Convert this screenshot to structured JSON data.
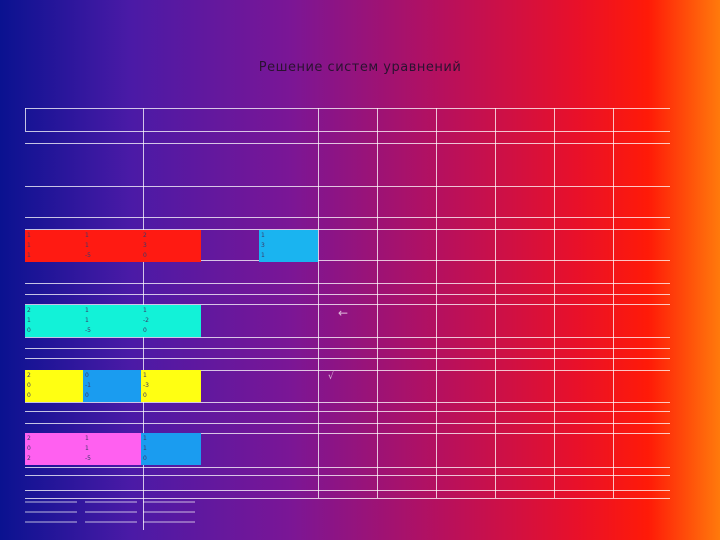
{
  "title": "Решение систем уравнений",
  "colors": {
    "red": "#ff1a12",
    "cyan": "#1ab4f0",
    "mint": "#12f2d8",
    "blue": "#1a9cf0",
    "yellow": "#ffff12",
    "pink": "#ff60f0"
  },
  "matrices": [
    {
      "name": "matrix-1-red",
      "rows": [
        [
          "1",
          "1",
          "2"
        ],
        [
          "1",
          "1",
          "3"
        ],
        [
          "1",
          "-5",
          "0"
        ]
      ]
    },
    {
      "name": "vector-1-cyan",
      "rows": [
        [
          "1"
        ],
        [
          "3"
        ],
        [
          "1"
        ]
      ]
    },
    {
      "name": "matrix-2-mint",
      "rows": [
        [
          "2",
          "1",
          "1"
        ],
        [
          "1",
          "1",
          "-2"
        ],
        [
          "0",
          "-5",
          "0"
        ]
      ]
    },
    {
      "name": "matrix-3-yellow",
      "rows": [
        [
          "2",
          "0",
          "1"
        ],
        [
          "0",
          "-1",
          "-3"
        ],
        [
          "0",
          "0",
          "0"
        ]
      ]
    },
    {
      "name": "matrix-4-pink",
      "rows": [
        [
          "2",
          "1",
          "1"
        ],
        [
          "0",
          "1",
          "1"
        ],
        [
          "2",
          "-5",
          "0"
        ]
      ]
    }
  ],
  "arrow": "←",
  "check_mark": "√"
}
